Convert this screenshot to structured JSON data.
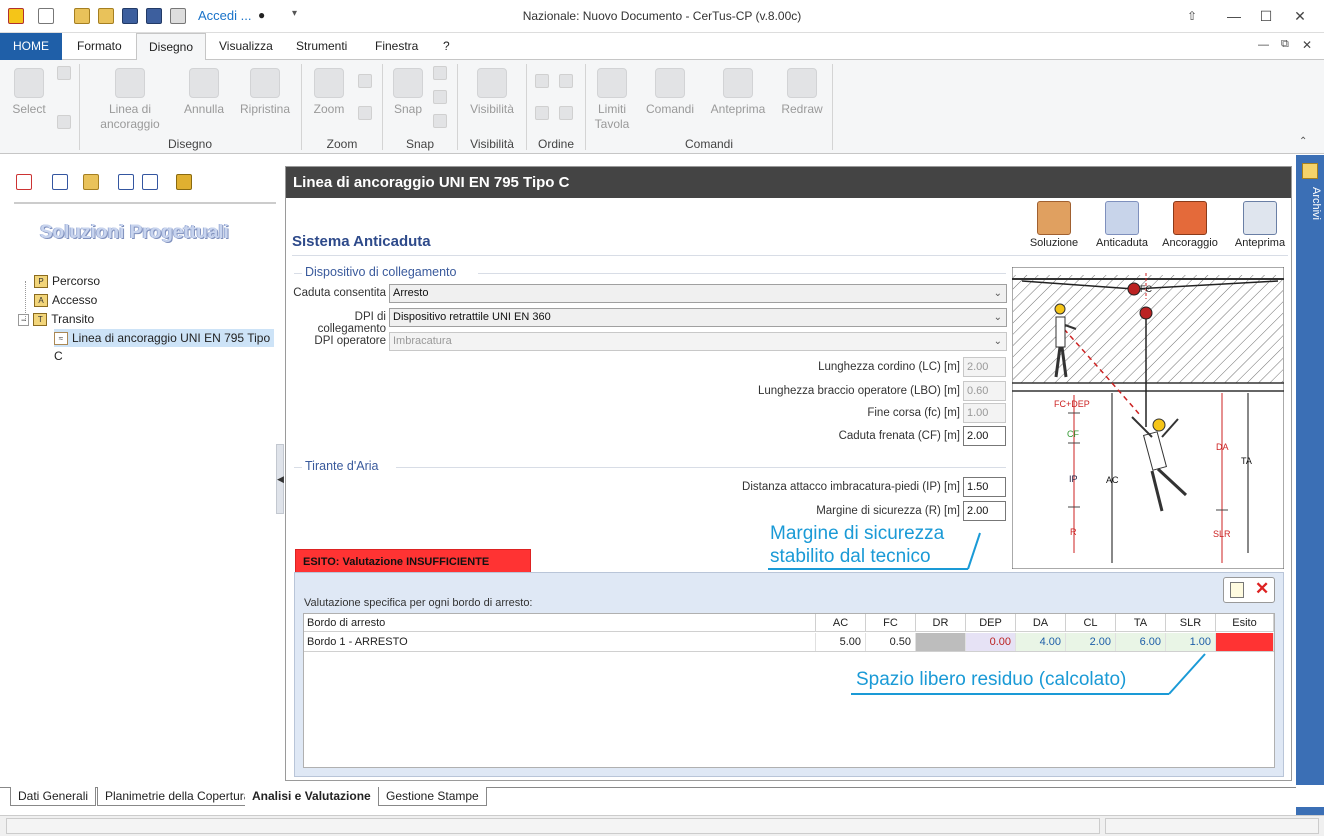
{
  "window": {
    "title": "Nazionale: Nuovo Documento - CerTus-CP (v.8.00c)",
    "login": "Accedi ..."
  },
  "ribbon": {
    "tabs": [
      "HOME",
      "Formato",
      "Disegno",
      "Visualizza",
      "Strumenti",
      "Finestra",
      "?"
    ],
    "active_tab": "Disegno",
    "buttons": {
      "select": "Select",
      "linea1": "Linea di",
      "linea2": "ancoraggio",
      "annulla": "Annulla",
      "ripristina": "Ripristina",
      "zoom": "Zoom",
      "snap": "Snap",
      "visibilita": "Visibilità",
      "limiti1": "Limiti",
      "limiti2": "Tavola",
      "comandi": "Comandi",
      "anteprima": "Anteprima",
      "redraw": "Redraw"
    },
    "groups": {
      "disegno": "Disegno",
      "zoom": "Zoom",
      "snap": "Snap",
      "visibilita": "Visibilità",
      "ordine": "Ordine",
      "comandi": "Comandi"
    }
  },
  "left": {
    "title": "Soluzioni Progettuali",
    "tree": [
      {
        "label": "Percorso",
        "icon": "P"
      },
      {
        "label": "Accesso",
        "icon": "A"
      },
      {
        "label": "Transito",
        "icon": "T"
      },
      {
        "label": "Linea di ancoraggio UNI EN 795 Tipo C",
        "icon": "anchor"
      }
    ]
  },
  "side_panel": {
    "label": "Archivi"
  },
  "main": {
    "title": "Linea di ancoraggio UNI EN 795 Tipo C",
    "heading": "Sistema Anticaduta",
    "toolbar": [
      "Soluzione",
      "Anticaduta",
      "Ancoraggio",
      "Anteprima"
    ],
    "section1": "Dispositivo di collegamento",
    "fields": {
      "caduta_label": "Caduta consentita",
      "caduta_value": "Arresto",
      "dpi_coll_label": "DPI di collegamento",
      "dpi_coll_value": "Dispositivo retrattile UNI EN 360",
      "dpi_op_label": "DPI operatore",
      "dpi_op_value": "Imbracatura",
      "lc_label": "Lunghezza cordino (LC) [m]",
      "lc_value": "2.00",
      "lbo_label": "Lunghezza braccio operatore (LBO) [m]",
      "lbo_value": "0.60",
      "fc_label": "Fine corsa (fc) [m]",
      "fc_value": "1.00",
      "cf_label": "Caduta frenata (CF) [m]",
      "cf_value": "2.00"
    },
    "section2": "Tirante d'Aria",
    "fields2": {
      "ip_label": "Distanza attacco imbracatura-piedi (IP) [m]",
      "ip_value": "1.50",
      "r_label": "Margine di sicurezza (R) [m]",
      "r_value": "2.00"
    },
    "note1_line1": "Margine di sicurezza",
    "note1_line2": "stabilito dal tecnico",
    "note2": "Spazio libero residuo (calcolato)",
    "diagram_labels": {
      "fc": "FC",
      "fcdep": "FC+DEP",
      "cf": "CF",
      "ip": "IP",
      "r": "R",
      "ac": "AC",
      "da": "DA",
      "ta": "TA",
      "slr": "SLR"
    },
    "esito": {
      "tab": "ESITO:  Valutazione INSUFFICIENTE",
      "subtitle": "Valutazione specifica per ogni bordo di arresto:",
      "columns": [
        "Bordo di arresto",
        "AC",
        "FC",
        "DR",
        "DEP",
        "DA",
        "CL",
        "TA",
        "SLR",
        "Esito"
      ],
      "row": {
        "bordo": "Bordo 1 - ARRESTO",
        "ac": "5.00",
        "fc": "0.50",
        "dr": "",
        "dep": "0.00",
        "da": "4.00",
        "cl": "2.00",
        "ta": "6.00",
        "slr": "1.00",
        "esito": ""
      },
      "esito_color": "#ff3333"
    }
  },
  "bottom_tabs": [
    "Dati Generali",
    "Planimetrie della Copertura",
    "Analisi e Valutazione",
    "Gestione Stampe"
  ],
  "active_bottom_tab": "Analisi e Valutazione"
}
